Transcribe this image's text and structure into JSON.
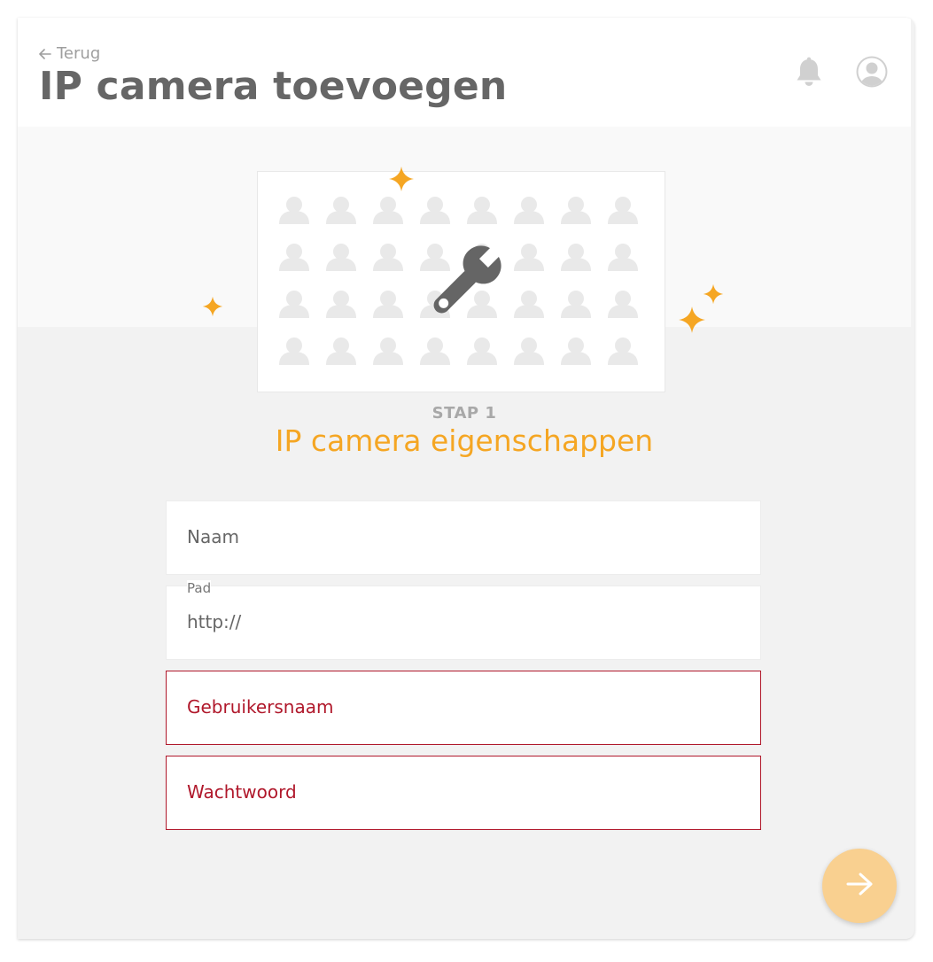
{
  "header": {
    "back_label": "Terug",
    "title": "IP camera toevoegen"
  },
  "icons": {
    "back": "arrow-left-icon",
    "notifications": "bell-icon",
    "profile": "user-avatar-icon",
    "illustration": "wrench-icon",
    "next": "arrow-right-icon"
  },
  "step": {
    "label": "STAP 1",
    "title": "IP camera eigenschappen"
  },
  "form": {
    "name": {
      "placeholder": "Naam"
    },
    "path": {
      "label": "Pad",
      "value": "http://"
    },
    "username": {
      "placeholder": "Gebruikersnaam"
    },
    "password": {
      "placeholder": "Wachtwoord"
    }
  },
  "colors": {
    "accent": "#f5a623",
    "error": "#b0182b",
    "title_gray": "#666666",
    "next_button": "#f9d090"
  }
}
